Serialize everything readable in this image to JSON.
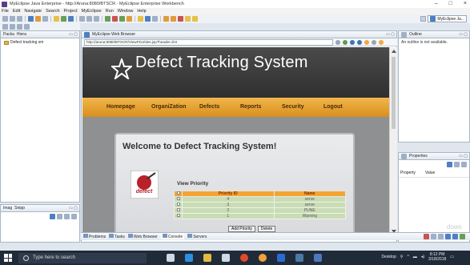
{
  "window": {
    "title": "MyEclipse Java Enterprise - http://Aruna:8080/BTSCR - MyEclipse Enterprise Workbench",
    "controls": [
      "–",
      "□",
      "×"
    ]
  },
  "menu": [
    "File",
    "Edit",
    "Navigate",
    "Search",
    "Project",
    "MyEclipse",
    "Run",
    "Window",
    "Help"
  ],
  "perspective": {
    "label": "MyEclipse Ja..."
  },
  "left_panel": {
    "tabs": [
      "Packa",
      "Hiera"
    ],
    "tree_item": "Defect tracking sm"
  },
  "left_bottom": {
    "tabs": [
      "Imag",
      "Snipp"
    ]
  },
  "browser": {
    "tab": "MyEclipse Web Browser",
    "url": "http://aruna:8080/BTSCR/ViewPriorities.jsp?header=list"
  },
  "site": {
    "title": "Defect Tracking System",
    "nav": [
      "Homepage",
      "OrganiZation",
      "Defects",
      "Reports",
      "Security",
      "Logout"
    ],
    "welcome": "Welcome to Defect Tracking System!",
    "section": "View Priority",
    "logo_text": "defect",
    "table": {
      "headers": [
        "",
        "Priority ID",
        "Name"
      ],
      "rows": [
        {
          "id": "4",
          "name": "serve"
        },
        {
          "id": "3",
          "name": "serve"
        },
        {
          "id": "2",
          "name": "PUNE"
        },
        {
          "id": "1",
          "name": "Warning"
        }
      ]
    },
    "buttons": {
      "add": "Add Priority",
      "delete": "Delete"
    }
  },
  "outline": {
    "tab": "Outline",
    "message": "An outline is not available."
  },
  "properties": {
    "tab": "Properties",
    "col_property": "Property",
    "col_value": "Value"
  },
  "bottom_tabs": [
    "Problems",
    "Tasks",
    "Web Browser",
    "Console",
    "Servers"
  ],
  "watermark": "dows",
  "taskbar": {
    "search_placeholder": "Type here to search",
    "desktop_label": "Desktop",
    "time": "8:12 PM",
    "date": "3/18/2018"
  },
  "colors": {
    "nav": "#e7a33a",
    "table_header": "#f3a534",
    "table_row": "#c9dcb4",
    "header_bg": "#3a3a3a"
  }
}
